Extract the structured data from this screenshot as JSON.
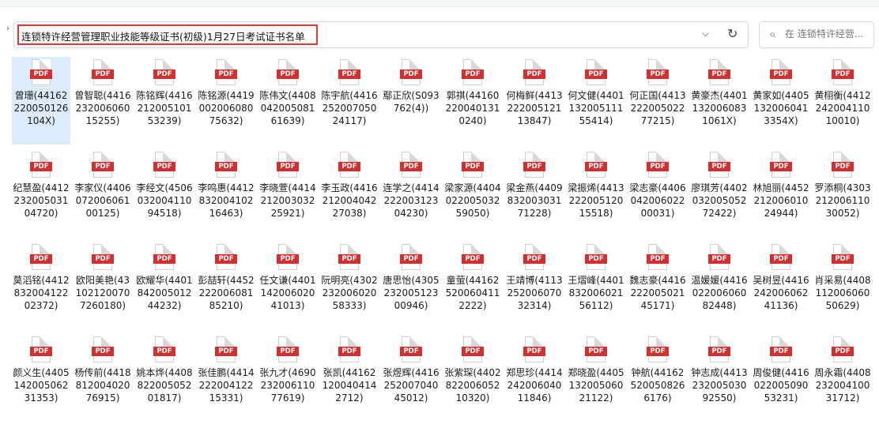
{
  "address_bar": {
    "path": "连锁特许经营管理职业技能等级证书(初级)1月27日考试证书名单",
    "search_placeholder": "在 连锁特许经营..."
  },
  "icons": {
    "file_type_label": "PDF",
    "chevron": "chevron-down-icon",
    "refresh": "refresh-icon",
    "search": "search-icon"
  },
  "colors": {
    "pdf_red": "#d32f2f",
    "highlight_border": "#e53935",
    "selection": "#dcecfc"
  },
  "files": [
    "曾珊(441622200501261​04X)",
    "曾智聪(44162320060601​5255)",
    "陈铭辉(44162120051015​3239)",
    "陈铭源(44190020060807​5632)",
    "陈伟文(44080420050816​1639)",
    "陈宇航(44162520070502​4117)",
    "鄢正欣(S093762(4))",
    "郭祺(44160220040131​0240)",
    "何梅鲜(44132220051211​3847)",
    "何文健(44011320051115​5414)",
    "何正国(44132220050227​7215)",
    "黄豪杰(44011320060831​061X)",
    "黄家如(44051320060413​354X)",
    "黄栩衡(44122420041101​0010)",
    "纪慧盈(44122320050310​4720)",
    "李家仪(44060720060610​0125)",
    "李经文(45060320041109​4518)",
    "李鸣惠(44128320041021​6463)",
    "李晓萱(44142120030322​5921)",
    "李玉政(44162120040422​7038)",
    "连学之(44142220031230​4230)",
    "梁家源(44040220050325​9050)",
    "梁金燕(44098320030317​1228)",
    "梁振烯(44132220051201​5518)",
    "梁志豪(44060420060220​0031)",
    "廖琪芳(44020320050527​2422)",
    "林旭丽(44522120060102​4944)",
    "罗添桐(43032120061103​0052)",
    "莫滔铭(44128320041220​2372)",
    "欧阳美艳(43102120070726​0180)",
    "欧耀华(44018420050124​4232)",
    "彭喆轩(44522220060818​5210)",
    "任文谦(44011420060204​1013)",
    "阮明亮(43022320060205​8333)",
    "唐思怡(43052320051230​0946)",
    "童萤(44162520060411​2222)",
    "王靖博(41132520060703​2314)",
    "王熠峰(44018320060215​6112)",
    "魏志豪(44162220050214​5171)",
    "温媛媛(44160220060608​2448)",
    "吴树昱(44162420060624​1136)",
    "肖采易(44081120060605​0629)",
    "颜义生(44051420050623​1353)",
    "杨传前(44188120040207​6915)",
    "姚本烨(44088220050520​1817)",
    "张佳鹏(44142220041221​5331)",
    "张九才(46902320061107​7619)",
    "张凯(44162120040414​2712)",
    "张煜辉(44162520070404​5012)",
    "张紫琛(44028220060521​0320)",
    "郑思珍(44142420060401​1846)",
    "郑晓盈(44051320050602​1122)",
    "钟航(44162520050826​6176)",
    "钟志成(44132320050309​2550)",
    "周俊健(44160220050905​3231)",
    "周永霜(44082320041003​1712)"
  ]
}
